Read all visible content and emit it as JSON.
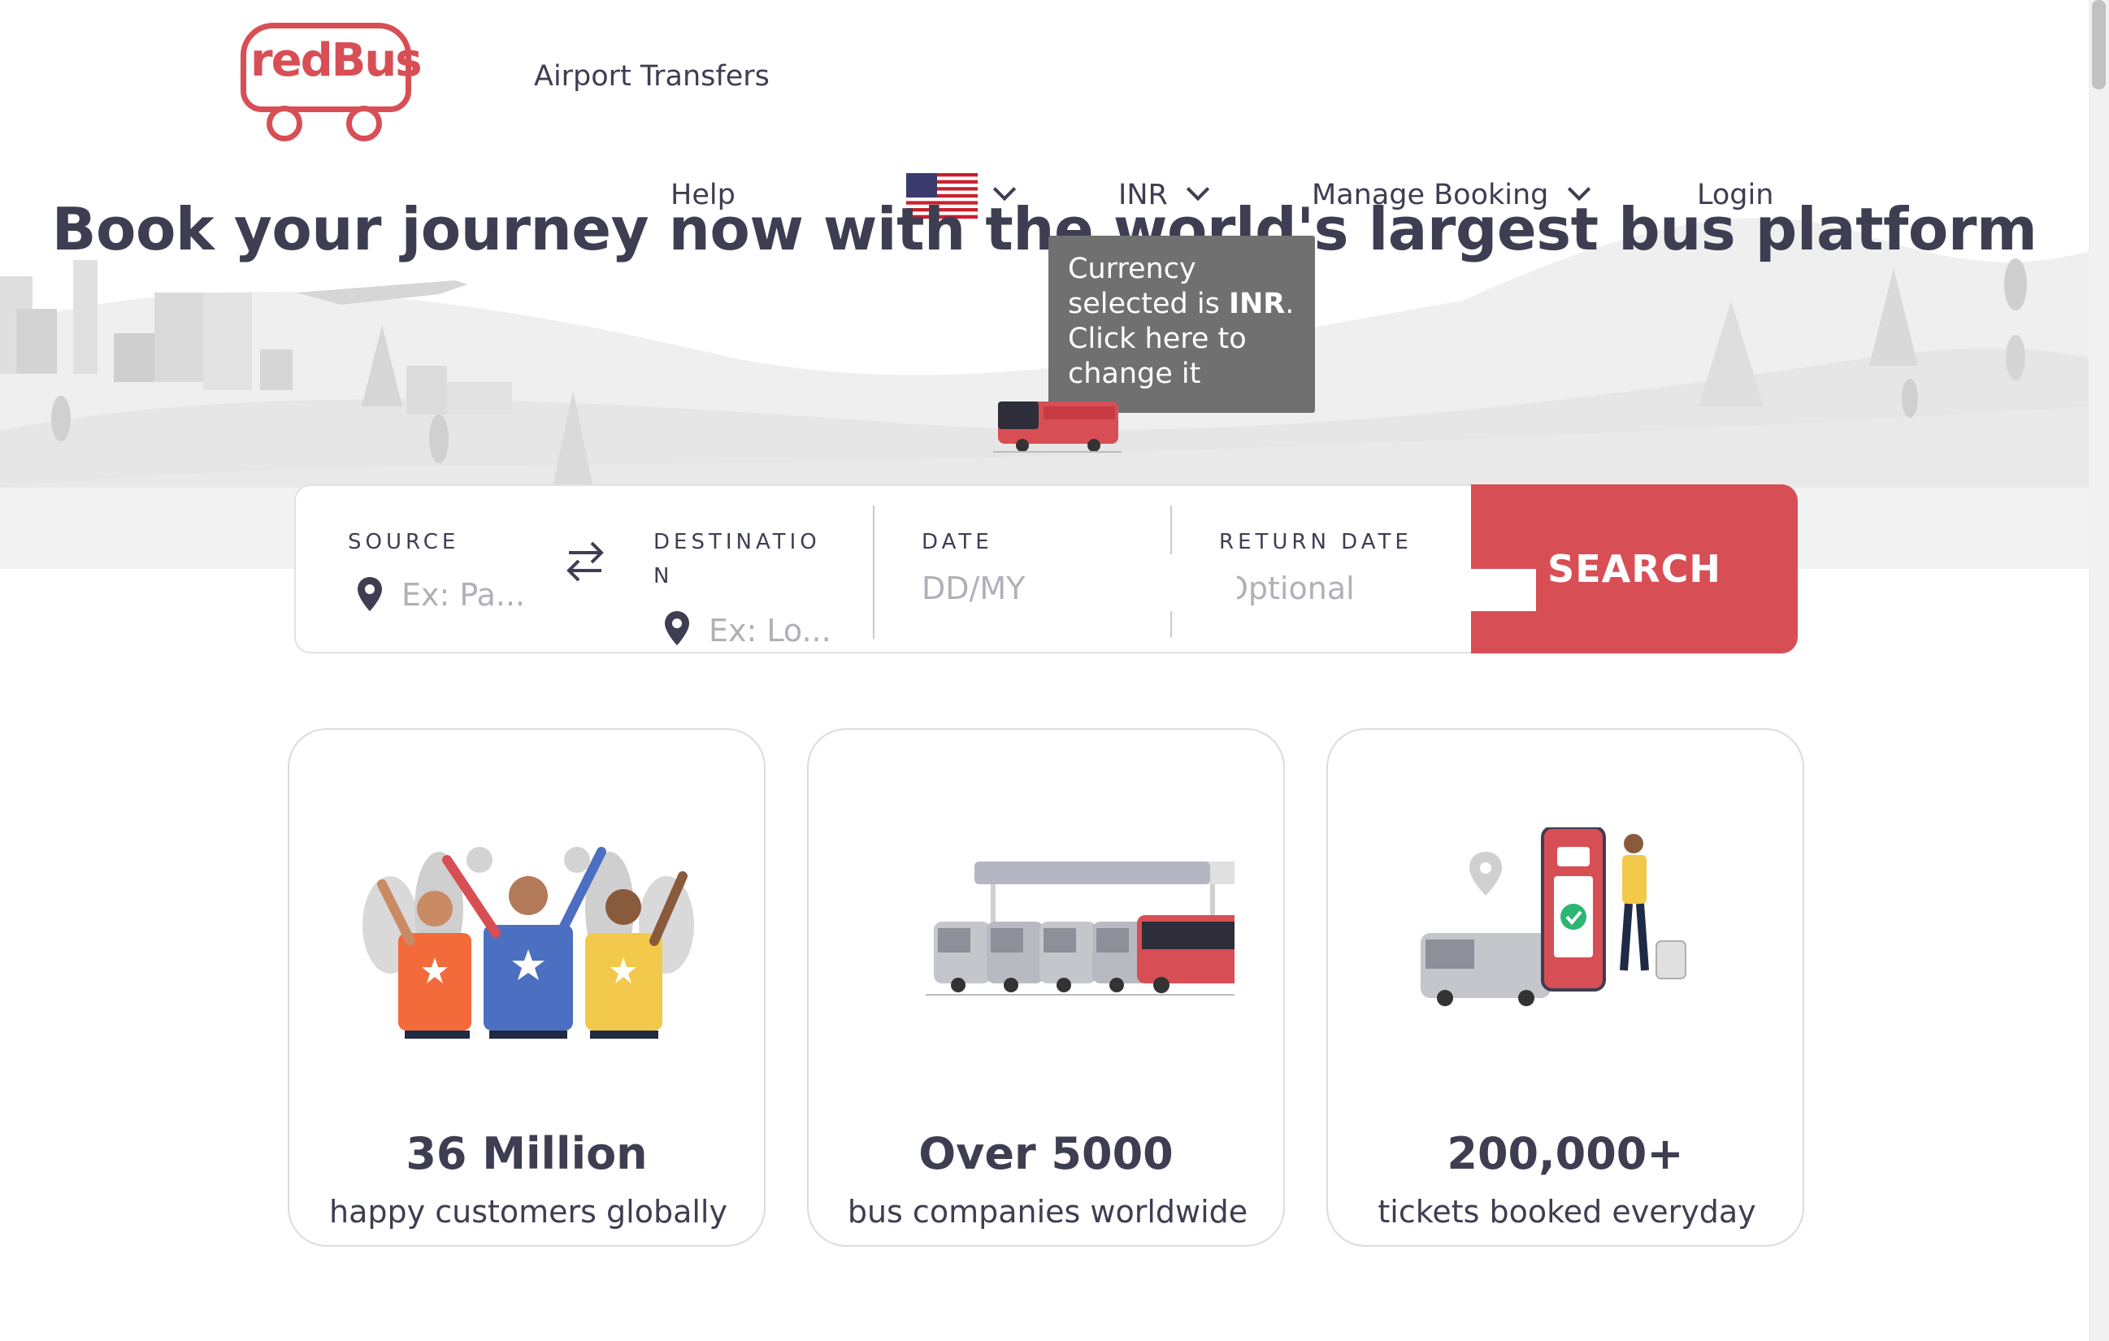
{
  "header": {
    "logo_text": "redBus",
    "airport_transfers": "Airport Transfers",
    "nav": {
      "help": "Help",
      "currency": "INR",
      "manage_booking": "Manage Booking",
      "login": "Login"
    }
  },
  "hero": {
    "headline": "Book your journey now with the world's largest bus platform",
    "tooltip": {
      "line1": "Currency",
      "line2_prefix": "selected is ",
      "line2_bold": "INR",
      "line2_suffix": ".",
      "line3": "Click here to",
      "line4": "change it"
    }
  },
  "search": {
    "source_label": "SOURCE",
    "source_placeholder": "Ex: Pa...",
    "destination_label_line1": "DESTINATIO",
    "destination_label_line2": "N",
    "destination_placeholder": "Ex: Lo...",
    "date_label": "DATE",
    "date_placeholder": "DD/MY",
    "return_label": "RETURN DATE",
    "return_placeholder": "Optional",
    "button": "SEARCH"
  },
  "stats": [
    {
      "value": "36 Million",
      "caption": "happy customers globally",
      "icon": "happy-customers-illustration"
    },
    {
      "value": "Over 5000",
      "caption": "bus companies worldwide",
      "icon": "bus-companies-illustration"
    },
    {
      "value": "200,000+",
      "caption": "tickets booked everyday",
      "icon": "tickets-booked-illustration"
    }
  ],
  "colors": {
    "brand": "#d84e55",
    "text": "#3e3e52",
    "tooltip_bg": "#707070"
  }
}
